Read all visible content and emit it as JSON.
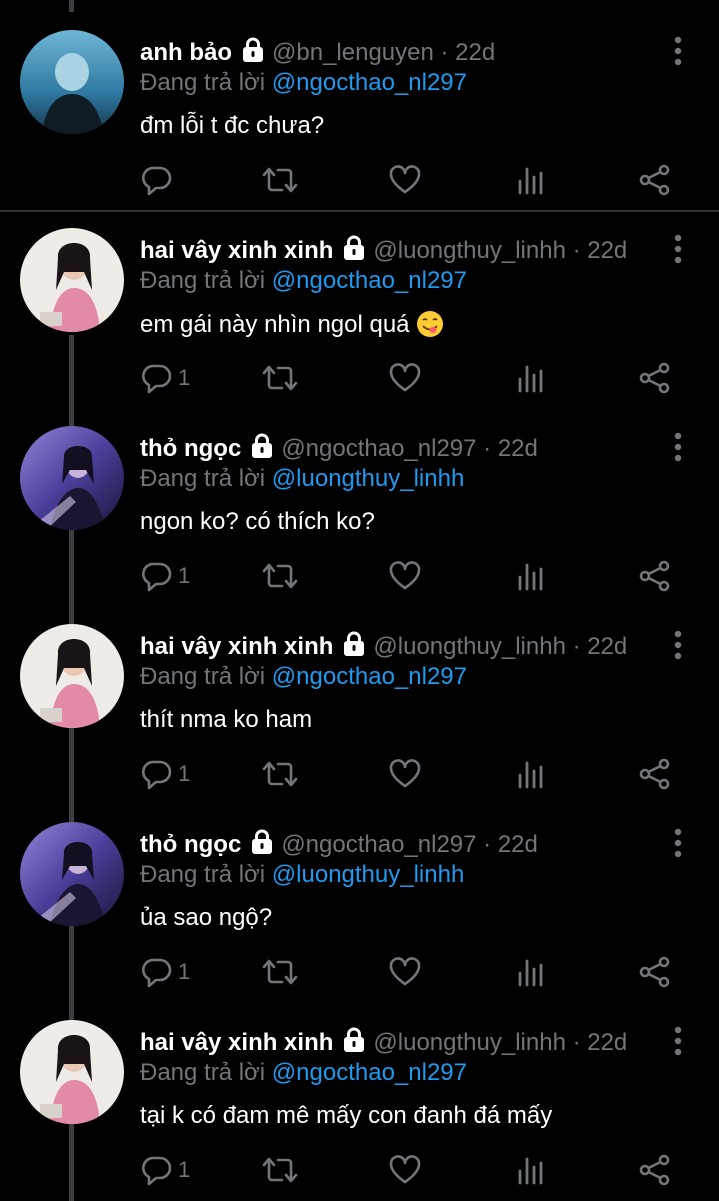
{
  "tweets": [
    {
      "name": "anh bảo",
      "handle": "@bn_lenguyen · 22d",
      "reply_prefix": "Đang trả lời ",
      "reply_to": "@ngocthao_nl297",
      "text": "đm lỗi t đc chưa?",
      "reply_count": "",
      "avatar": "avatar-blue-hair"
    },
    {
      "name": "hai vây xinh xinh",
      "handle": "@luongthuy_linhh · 22d",
      "reply_prefix": "Đang trả lời ",
      "reply_to": "@ngocthao_nl297",
      "text": "em gái này nhìn ngol quá",
      "reply_count": "1",
      "avatar": "avatar-pink-girl"
    },
    {
      "name": "thỏ ngọc",
      "handle": "@ngocthao_nl297 · 22d",
      "reply_prefix": "Đang trả lời ",
      "reply_to": "@luongthuy_linhh",
      "text": "ngon ko? có thích ko?",
      "reply_count": "1",
      "avatar": "avatar-purple-girl"
    },
    {
      "name": "hai vây xinh xinh",
      "handle": "@luongthuy_linhh · 22d",
      "reply_prefix": "Đang trả lời ",
      "reply_to": "@ngocthao_nl297",
      "text": "thít nma ko ham",
      "reply_count": "1",
      "avatar": "avatar-pink-girl"
    },
    {
      "name": "thỏ ngọc",
      "handle": "@ngocthao_nl297 · 22d",
      "reply_prefix": "Đang trả lời ",
      "reply_to": "@luongthuy_linhh",
      "text": "ủa sao ngộ?",
      "reply_count": "1",
      "avatar": "avatar-purple-girl"
    },
    {
      "name": "hai vây xinh xinh",
      "handle": "@luongthuy_linhh · 22d",
      "reply_prefix": "Đang trả lời ",
      "reply_to": "@ngocthao_nl297",
      "text": "tại k có đam mê mấy con đanh đá mấy",
      "reply_count": "1",
      "avatar": "avatar-pink-girl"
    }
  ],
  "icons": {
    "reply": "reply-icon",
    "retweet": "retweet-icon",
    "like": "heart-icon",
    "views": "analytics-icon",
    "share": "share-icon",
    "more": "more-vertical-icon",
    "lock": "lock-icon",
    "emoji": "savoring-food-emoji"
  },
  "colors": {
    "background": "#000000",
    "text": "#ffffff",
    "secondary": "#71767b",
    "mention": "#1d9bf0",
    "thread_line": "#3a3d41"
  }
}
